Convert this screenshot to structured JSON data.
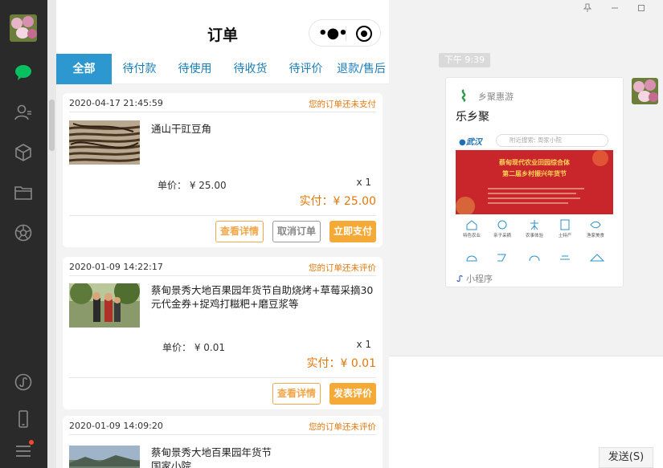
{
  "app": {
    "nav_title": "订单",
    "tabs": [
      "全部",
      "待付款",
      "待使用",
      "待收货",
      "待评价",
      "退款/售后"
    ],
    "active_tab": "全部",
    "more_glyph": "•●•"
  },
  "orders": [
    {
      "date": "2020-04-17 21:45:59",
      "status": "您的订单还未支付",
      "name": "通山干豇豆角",
      "price": "单价： ¥ 25.00",
      "qty": "x 1",
      "paid": "实付：¥ 25.00",
      "buttons": [
        "查看详情",
        "取消订单",
        "立即支付"
      ]
    },
    {
      "date": "2020-01-09 14:22:17",
      "status": "您的订单还未评价",
      "name": "蔡甸景秀大地百果园年货节自助烧烤+草莓采摘30元代金券+捉鸡打糍粑+磨豆浆等",
      "price": "单价： ¥ 0.01",
      "qty": "x 1",
      "paid": "实付：¥ 0.01",
      "buttons": [
        "查看详情",
        "发表评价"
      ]
    },
    {
      "date": "2020-01-09 14:09:20",
      "status": "您的订单还未评价",
      "name": "蔡甸景秀大地百果园年货节 国家小院"
    }
  ],
  "chat": {
    "timestamp": "下午 9:39",
    "mini_program": {
      "source": "乡聚惠游",
      "title": "乐乡聚",
      "location": "武汉",
      "search_placeholder": "附近搜索: 周家小院",
      "banner_line1": "蔡甸现代农业田园综合体",
      "banner_line2": "第二届乡村振兴年货节",
      "grid_labels": [
        "特色农业",
        "亲子采摘",
        "农事体验",
        "土特产",
        "渔家美食"
      ],
      "footer": "小程序"
    },
    "send_label": "发送(S)"
  },
  "colors": {
    "tab_active_bg": "#2c98cf",
    "tab_text": "#1a7fb8",
    "accent_orange": "#e0780c",
    "button_fill": "#f5a936",
    "rail_bg": "#2a2a2a",
    "wechat_green": "#07c160"
  }
}
